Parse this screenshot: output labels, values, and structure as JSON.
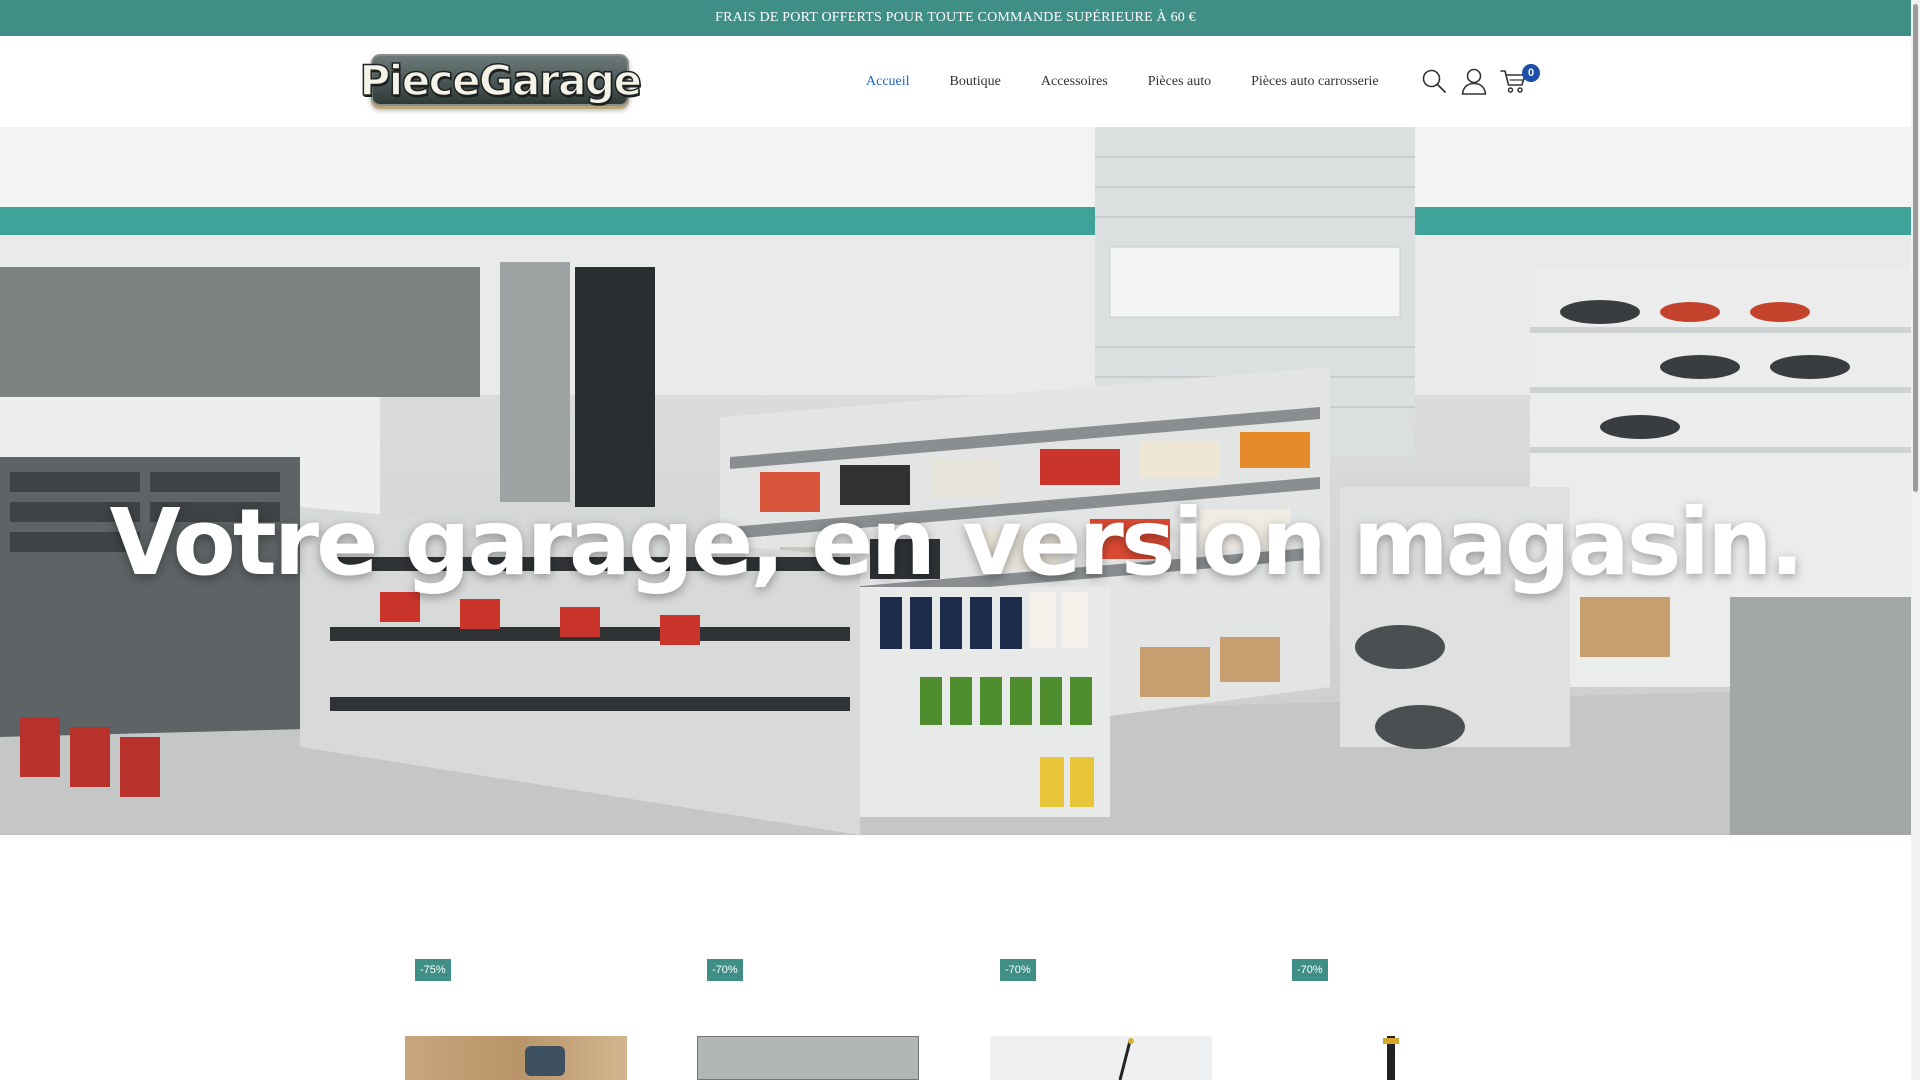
{
  "promo": {
    "text": "FRAIS DE PORT OFFERTS POUR TOUTE COMMANDE SUPÉRIEURE À 60 €"
  },
  "header": {
    "logo_text": "PieceGarage",
    "nav": [
      {
        "label": "Accueil",
        "active": true
      },
      {
        "label": "Boutique"
      },
      {
        "label": "Accessoires"
      },
      {
        "label": "Pièces auto"
      },
      {
        "label": "Pièces auto carrosserie"
      }
    ],
    "icons": {
      "search": "search-icon",
      "account": "user-icon",
      "cart": "cart-icon"
    },
    "cart_count": "0"
  },
  "hero": {
    "headline": "Votre garage, en version magasin."
  },
  "products": [
    {
      "discount": "-75%"
    },
    {
      "discount": "-70%"
    },
    {
      "discount": "-70%"
    },
    {
      "discount": "-70%"
    }
  ],
  "colors": {
    "accent": "#3f8f86",
    "nav_active": "#1e63c8",
    "badge": "#1d4fa8"
  }
}
